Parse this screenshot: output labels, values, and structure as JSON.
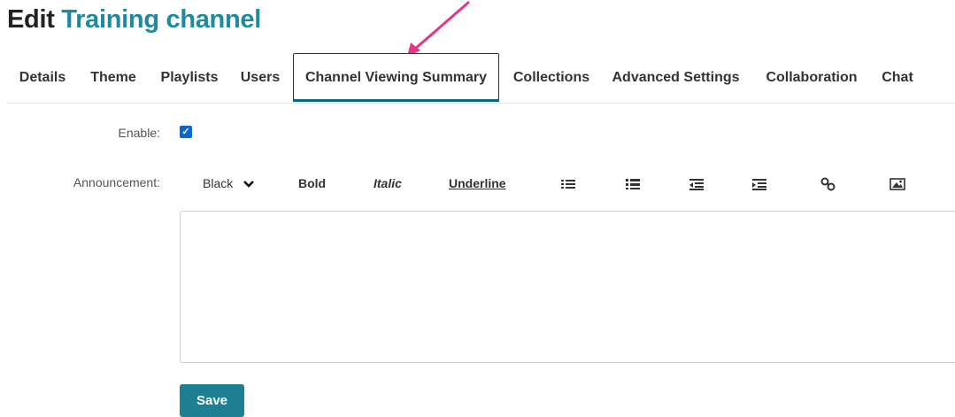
{
  "page": {
    "title_prefix": "Edit",
    "title_channel": "Training channel"
  },
  "tabs": [
    {
      "label": "Details"
    },
    {
      "label": "Theme"
    },
    {
      "label": "Playlists"
    },
    {
      "label": "Users"
    },
    {
      "label": "Channel Viewing Summary",
      "active": true
    },
    {
      "label": "Collections"
    },
    {
      "label": "Advanced Settings"
    },
    {
      "label": "Collaboration"
    },
    {
      "label": "Chat"
    }
  ],
  "form": {
    "enable_label": "Enable:",
    "enable_checked": true,
    "announcement_label": "Announcement:",
    "announcement_value": "",
    "save_label": "Save"
  },
  "toolbar": {
    "color_value": "Black",
    "bold_label": "Bold",
    "italic_label": "Italic",
    "underline_label": "Underline",
    "icons": [
      "unordered-list-icon",
      "ordered-list-icon",
      "outdent-icon",
      "indent-icon",
      "link-icon",
      "image-icon"
    ]
  },
  "colors": {
    "channel_title": "#1f8a9c",
    "active_tab_underline": "#0b6a7a",
    "save_button": "#1d7f92",
    "checkbox": "#0a67d0",
    "annotation_arrow": "#e8338a"
  }
}
